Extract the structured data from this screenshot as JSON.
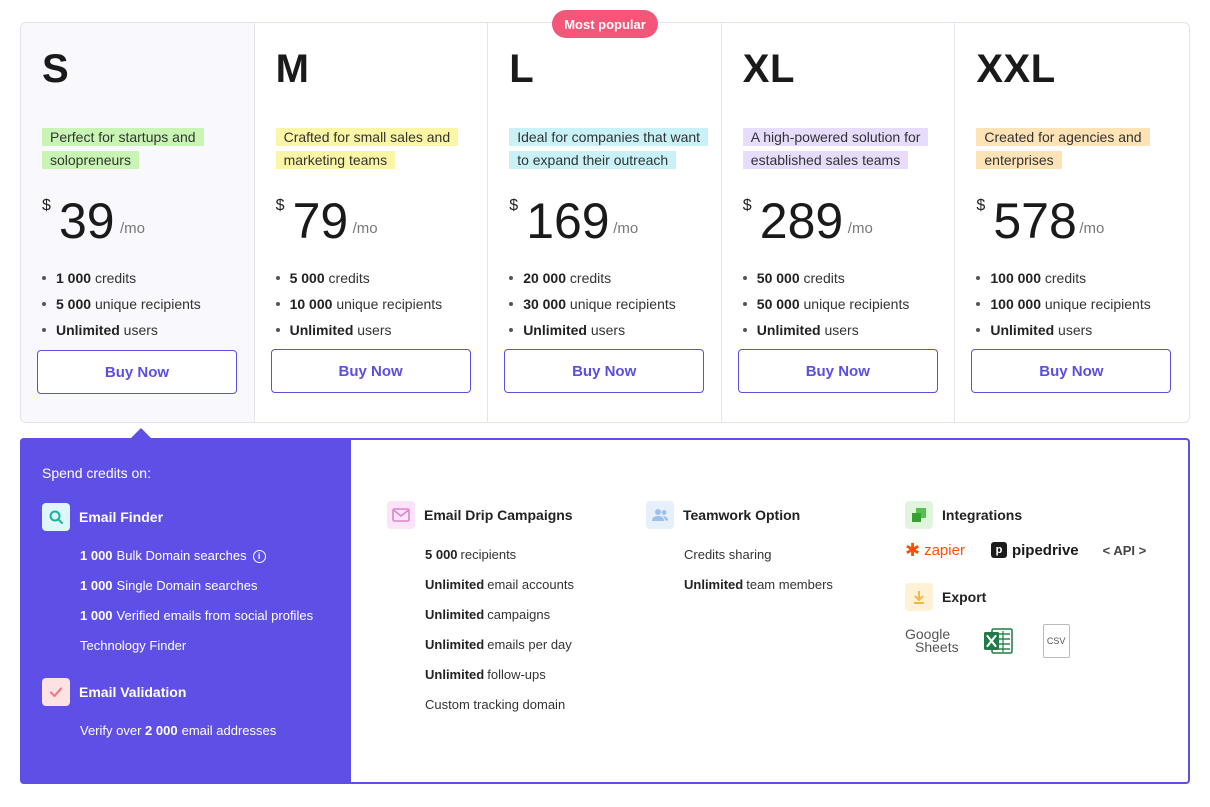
{
  "badge": "Most popular",
  "plans": [
    {
      "name": "S",
      "desc": "Perfect for startups and solopreneurs",
      "currency": "$",
      "price": "39",
      "period": "/mo",
      "f1_bold": "1 000",
      "f1_text": "credits",
      "f2_bold": "5 000",
      "f2_text": "unique recipients",
      "f3_bold": "Unlimited",
      "f3_text": "users",
      "button": "Buy Now",
      "highlight": "#c9f5b4"
    },
    {
      "name": "M",
      "desc": "Crafted for small sales and marketing teams",
      "currency": "$",
      "price": "79",
      "period": "/mo",
      "f1_bold": "5 000",
      "f1_text": "credits",
      "f2_bold": "10 000",
      "f2_text": "unique recipients",
      "f3_bold": "Unlimited",
      "f3_text": "users",
      "button": "Buy Now",
      "highlight": "#fbf6a6"
    },
    {
      "name": "L",
      "desc": "Ideal for companies that want to expand their outreach",
      "currency": "$",
      "price": "169",
      "period": "/mo",
      "f1_bold": "20 000",
      "f1_text": "credits",
      "f2_bold": "30 000",
      "f2_text": "unique recipients",
      "f3_bold": "Unlimited",
      "f3_text": "users",
      "button": "Buy Now",
      "highlight": "#c8f2f8"
    },
    {
      "name": "XL",
      "desc": "A high-powered solution for established sales teams",
      "currency": "$",
      "price": "289",
      "period": "/mo",
      "f1_bold": "50 000",
      "f1_text": "credits",
      "f2_bold": "50 000",
      "f2_text": "unique recipients",
      "f3_bold": "Unlimited",
      "f3_text": "users",
      "button": "Buy Now",
      "highlight": "#e7dcfb"
    },
    {
      "name": "XXL",
      "desc": "Created for agencies and enterprises",
      "currency": "$",
      "price": "578",
      "period": "/mo",
      "f1_bold": "100 000",
      "f1_text": "credits",
      "f2_bold": "100 000",
      "f2_text": "unique recipients",
      "f3_bold": "Unlimited",
      "f3_text": "users",
      "button": "Buy Now",
      "highlight": "#fde3b6"
    }
  ],
  "spend": {
    "title": "Spend credits on:",
    "email_finder": {
      "label": "Email Finder",
      "items": [
        {
          "bold": "1 000",
          "text": "Bulk Domain searches"
        },
        {
          "bold": "1 000",
          "text": "Single Domain searches"
        },
        {
          "bold": "1 000",
          "text": "Verified emails from social profiles"
        },
        {
          "bold": "",
          "text": "Technology Finder"
        }
      ],
      "info_glyph": "i"
    },
    "email_validation": {
      "label": "Email Validation",
      "item_pre": "Verify over",
      "item_bold": "2 000",
      "item_post": "email addresses"
    }
  },
  "drip": {
    "label": "Email Drip Campaigns",
    "items": [
      {
        "bold": "5 000",
        "text": "recipients"
      },
      {
        "bold": "Unlimited",
        "text": "email accounts"
      },
      {
        "bold": "Unlimited",
        "text": "campaigns"
      },
      {
        "bold": "Unlimited",
        "text": "emails per day"
      },
      {
        "bold": "Unlimited",
        "text": "follow-ups"
      },
      {
        "bold": "",
        "text": "Custom tracking domain"
      }
    ]
  },
  "teamwork": {
    "label": "Teamwork Option",
    "items": [
      {
        "bold": "",
        "text": "Credits sharing"
      },
      {
        "bold": "Unlimited",
        "text": "team members"
      }
    ]
  },
  "integrations": {
    "label": "Integrations",
    "zapier": "zapier",
    "pipedrive": "pipedrive",
    "pipedrive_mark": "p",
    "api": "< API >"
  },
  "export": {
    "label": "Export",
    "google_1": "Google",
    "google_2": "Sheets",
    "csv": "CSV"
  },
  "colors": {
    "accent": "#5e4fe7",
    "button_text": "#5b4fe0",
    "badge": "#f4567a"
  }
}
